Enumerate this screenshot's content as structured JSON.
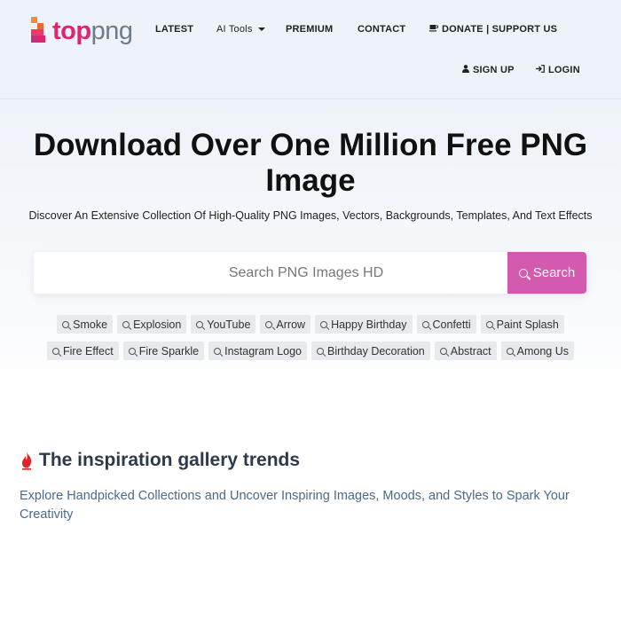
{
  "brand": {
    "logo_part1": "top",
    "logo_part2": "png"
  },
  "nav": {
    "latest": "LATEST",
    "ai_tools": "AI Tools",
    "premium": "PREMIUM",
    "contact": "CONTACT",
    "donate": "DONATE | SUPPORT US",
    "sign_up": "SIGN UP",
    "login": "LOGIN"
  },
  "hero": {
    "title": "Download Over One Million Free PNG Image",
    "subtitle": "Discover An Extensive Collection Of High-Quality PNG Images, Vectors, Backgrounds, Templates, And Text Effects"
  },
  "search": {
    "placeholder": "Search PNG Images HD",
    "value": "",
    "button_label": "Search"
  },
  "tags": {
    "row1": [
      "Smoke",
      "Explosion",
      "YouTube",
      "Arrow",
      "Happy Birthday",
      "Confetti",
      "Paint Splash"
    ],
    "row2": [
      "Fire Effect",
      "Fire Sparkle",
      "Instagram Logo",
      "Birthday Decoration",
      "Abstract",
      "Among Us"
    ]
  },
  "inspiration": {
    "title": "The inspiration gallery trends",
    "description": "Explore Handpicked Collections and Uncover Inspiring Images, Moods, and Styles to Spark Your Creativity"
  },
  "icons": {
    "donate": "coffee-icon",
    "sign_up": "user-icon",
    "login": "sign-in-icon",
    "search": "search-icon",
    "trend": "flame-icon"
  },
  "colors": {
    "brand_pink": "#e0246f",
    "search_button": "#d35aae",
    "header_bg": "#eef3f9",
    "tag_bg": "#e8eaee",
    "flame": "#e02424"
  }
}
